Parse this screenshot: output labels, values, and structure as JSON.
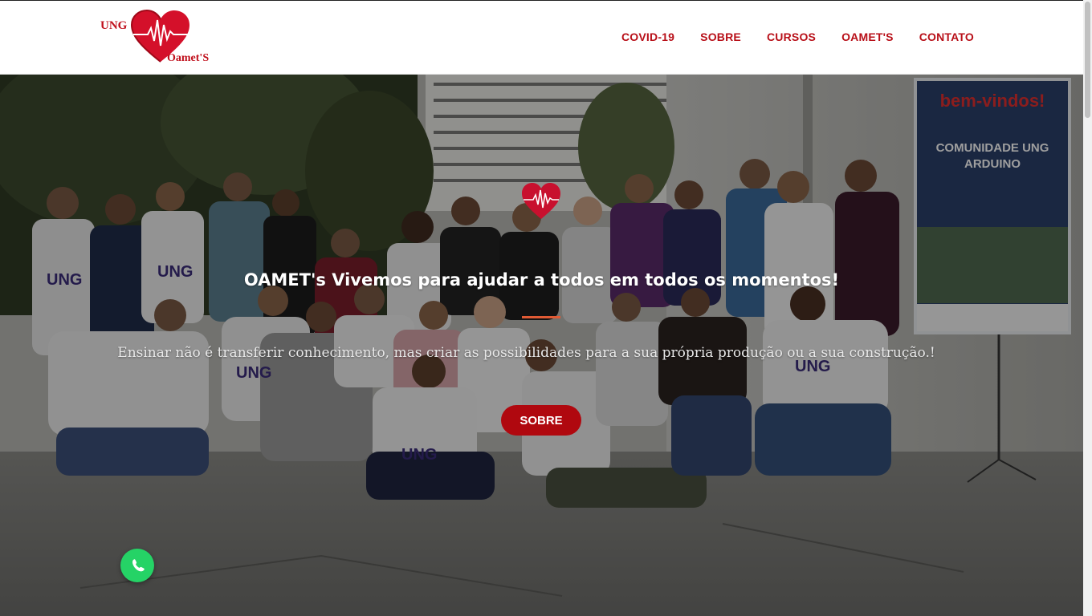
{
  "logo": {
    "line1": "UNG",
    "line2": "Oamet'S",
    "icon": "heart-ecg-icon",
    "color": "#c0101c"
  },
  "nav": {
    "items": [
      {
        "label": "COVID-19"
      },
      {
        "label": "SOBRE"
      },
      {
        "label": "CURSOS"
      },
      {
        "label": "OAMET'S"
      },
      {
        "label": "CONTATO"
      }
    ],
    "color": "#b80f18"
  },
  "hero": {
    "title": "OAMET's Vivemos para ajudar a todos em todos os momentos!",
    "subtitle": "Ensinar não é transferir conhecimento, mas criar as possibilidades para a sua própria produção ou a sua construção.!",
    "button_label": "SOBRE",
    "button_color": "#b0080f",
    "divider_color": "#e05a34",
    "banner": {
      "greeting": "bem-vindos!",
      "line1": "COMUNIDADE UNG",
      "line2": "ARDUINO"
    },
    "shirt_text": "UNG"
  },
  "whatsapp": {
    "icon": "whatsapp-icon",
    "color": "#25d366"
  }
}
